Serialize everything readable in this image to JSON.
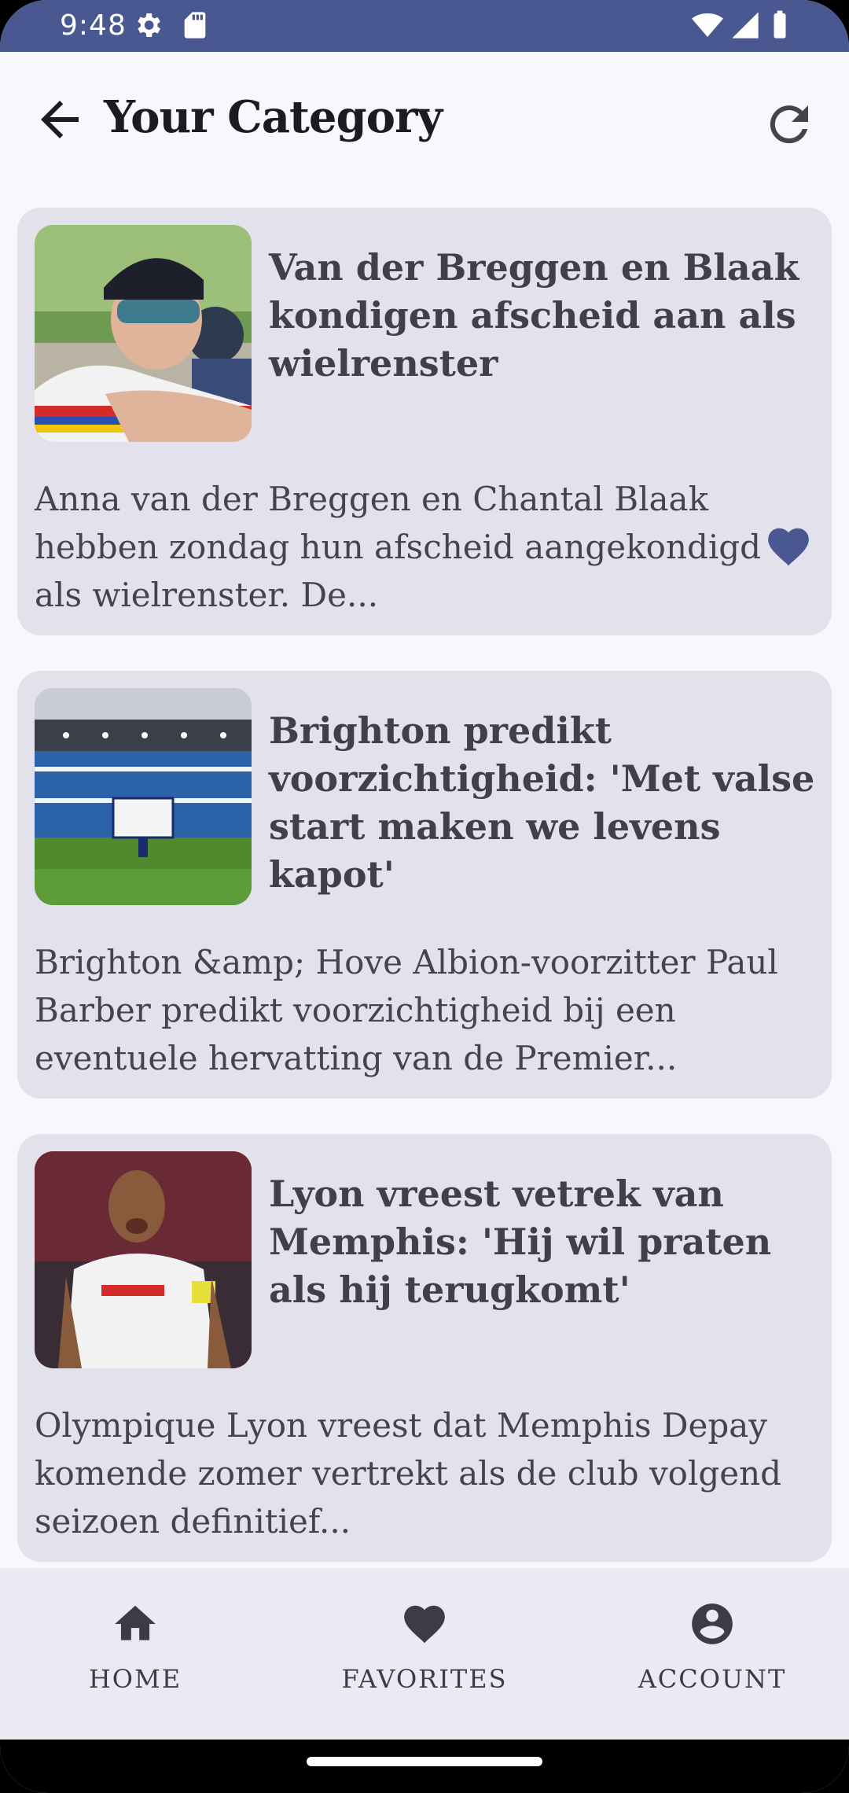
{
  "status_bar": {
    "time": "9:48",
    "icons": [
      "settings-icon",
      "sim-card-icon",
      "wifi-icon",
      "signal-icon",
      "battery-icon"
    ]
  },
  "app_bar": {
    "title": "Your Category",
    "back_icon": "arrow-back-icon",
    "refresh_icon": "refresh-icon"
  },
  "articles": [
    {
      "title": "Van der Breggen en Blaak kondigen afscheid aan als wielrenster",
      "description": "Anna van der Breggen en Chantal Blaak hebben zondag hun afscheid aangekondigd als wielrenster. De...",
      "favorited": true,
      "image": "cyclist-photo"
    },
    {
      "title": "Brighton predikt voorzichtigheid: 'Met valse start maken we levens kapot'",
      "description": "Brighton &amp; Hove Albion-voorzitter Paul Barber predikt voorzichtigheid bij een eventuele hervatting van de Premier...",
      "favorited": false,
      "image": "stadium-photo"
    },
    {
      "title": "Lyon vreest vetrek van Memphis: 'Hij wil praten als hij terugkomt'",
      "description": "Olympique Lyon vreest dat Memphis Depay komende zomer vertrekt als de club volgend seizoen definitief...",
      "favorited": false,
      "image": "footballer-photo"
    }
  ],
  "bottom_nav": {
    "items": [
      {
        "label": "HOME",
        "icon": "home-icon"
      },
      {
        "label": "FAVORITES",
        "icon": "heart-icon"
      },
      {
        "label": "ACCOUNT",
        "icon": "account-circle-icon"
      }
    ]
  },
  "colors": {
    "status_bar": "#4a5891",
    "card_bg": "#e3e2ec",
    "accent": "#4a5891",
    "nav_bg": "#ebeaf3"
  }
}
